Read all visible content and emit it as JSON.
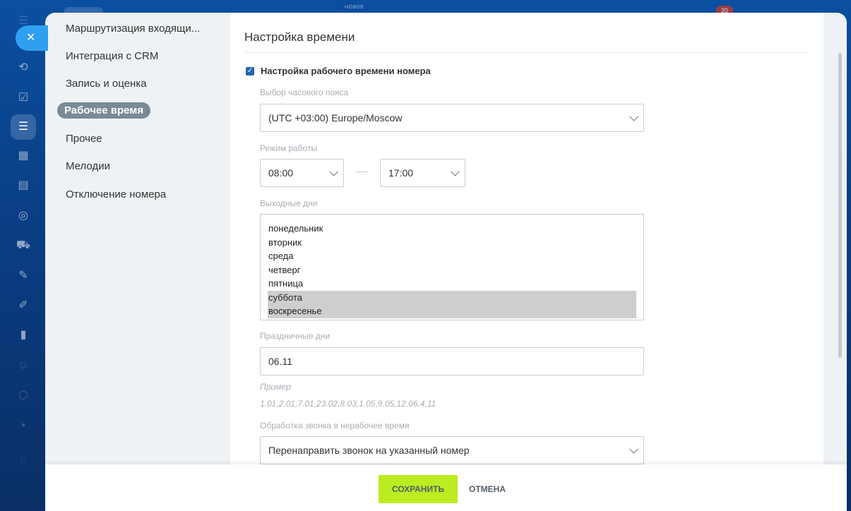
{
  "background": {
    "new_label": "НОВОЕ",
    "counter": "20"
  },
  "close_button": {
    "icon": "close-icon",
    "symbol": "✕"
  },
  "rail_icons": [
    {
      "name": "menu-icon",
      "glyph": "☰"
    },
    {
      "name": "activity-icon",
      "glyph": "⟲"
    },
    {
      "name": "tasks-icon",
      "glyph": "☑"
    },
    {
      "name": "filter-icon",
      "glyph": "☰"
    },
    {
      "name": "calendar-icon",
      "glyph": "▦"
    },
    {
      "name": "storage-icon",
      "glyph": "▤"
    },
    {
      "name": "target-icon",
      "glyph": "◎"
    },
    {
      "name": "cart-icon",
      "glyph": "⛟"
    },
    {
      "name": "edit-doc-icon",
      "glyph": "✎"
    },
    {
      "name": "pen-icon",
      "glyph": "✐"
    },
    {
      "name": "chart-icon",
      "glyph": "▮"
    },
    {
      "name": "robot-icon",
      "glyph": "☺"
    },
    {
      "name": "cube-icon",
      "glyph": "⬡"
    },
    {
      "name": "apps-icon",
      "glyph": "▪"
    },
    {
      "name": "settings-icon",
      "glyph": "◌"
    }
  ],
  "sidenav": {
    "items": [
      {
        "label": "Маршрутизация входящи...",
        "active": false
      },
      {
        "label": "Интеграция с CRM",
        "active": false
      },
      {
        "label": "Запись и оценка",
        "active": false
      },
      {
        "label": "Рабочее время",
        "active": true
      },
      {
        "label": "Прочее",
        "active": false
      },
      {
        "label": "Мелодии",
        "active": false
      },
      {
        "label": "Отключение номера",
        "active": false
      }
    ]
  },
  "content": {
    "title": "Настройка времени",
    "worktime_checkbox": {
      "label": "Настройка рабочего времени номера",
      "checked": true
    },
    "timezone": {
      "label": "Выбор часового пояса",
      "value": "(UTC +03:00) Europe/Moscow"
    },
    "work_mode": {
      "label": "Режим работы",
      "from": "08:00",
      "to": "17:00"
    },
    "weekend": {
      "label": "Выходные дни",
      "options": [
        {
          "label": "понедельник",
          "selected": false
        },
        {
          "label": "вторник",
          "selected": false
        },
        {
          "label": "среда",
          "selected": false
        },
        {
          "label": "четверг",
          "selected": false
        },
        {
          "label": "пятница",
          "selected": false
        },
        {
          "label": "суббота",
          "selected": true
        },
        {
          "label": "воскресенье",
          "selected": true
        }
      ]
    },
    "holidays": {
      "label": "Праздничные дни",
      "value": "06.11",
      "example_label": "Пример",
      "example_value": "1.01,2.01,7.01,23.02,8.03,1.05,9.05,12.06,4.11"
    },
    "after_hours": {
      "label": "Обработка звонка в нерабочее время",
      "value": "Перенаправить звонок на указанный номер"
    }
  },
  "footer": {
    "save_label": "СОХРАНИТЬ",
    "cancel_label": "ОТМЕНА"
  },
  "colors": {
    "save_button": "#bbed21",
    "active_nav": "#7a8a96",
    "close_button": "#2fa0ef"
  }
}
